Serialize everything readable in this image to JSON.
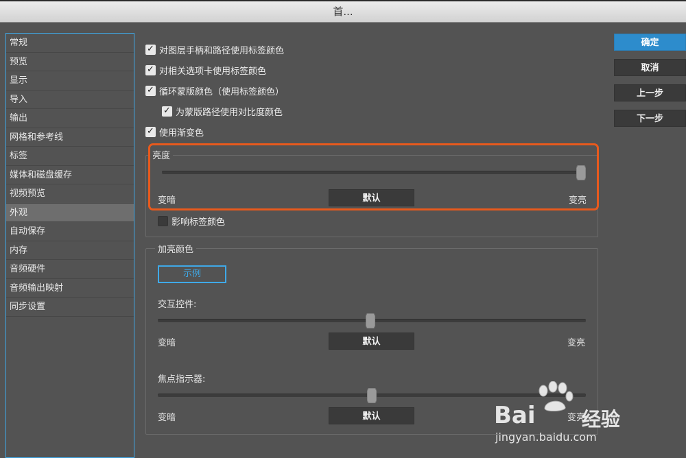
{
  "window": {
    "title": "首..."
  },
  "sidebar": {
    "items": [
      {
        "label": "常规"
      },
      {
        "label": "预览"
      },
      {
        "label": "显示"
      },
      {
        "label": "导入"
      },
      {
        "label": "输出"
      },
      {
        "label": "网格和参考线"
      },
      {
        "label": "标签"
      },
      {
        "label": "媒体和磁盘缓存"
      },
      {
        "label": "视频预览"
      },
      {
        "label": "外观"
      },
      {
        "label": "自动保存"
      },
      {
        "label": "内存"
      },
      {
        "label": "音频硬件"
      },
      {
        "label": "音频输出映射"
      },
      {
        "label": "同步设置"
      }
    ],
    "selected": "外观"
  },
  "options": {
    "layer_handles": {
      "label": "对图层手柄和路径使用标签颜色",
      "checked": true
    },
    "related_tabs": {
      "label": "对相关选项卡使用标签颜色",
      "checked": true
    },
    "cycle_mask": {
      "label": "循环蒙版颜色（使用标签颜色）",
      "checked": true
    },
    "mask_contrast": {
      "label": "为蒙版路径使用对比度颜色",
      "checked": true
    },
    "use_gradients": {
      "label": "使用渐变色",
      "checked": true
    },
    "affect_label": {
      "label": "影响标签颜色",
      "checked": false
    }
  },
  "brightness": {
    "title": "亮度",
    "darker": "变暗",
    "default_label": "默认",
    "lighter": "变亮",
    "value": 1.0
  },
  "highlight": {
    "title": "加亮颜色",
    "sample_label": "示例",
    "interactive": {
      "label": "交互控件:",
      "darker": "变暗",
      "default_label": "默认",
      "lighter": "变亮",
      "value": 0.5
    },
    "focus": {
      "label": "焦点指示器:",
      "darker": "变暗",
      "default_label": "默认",
      "lighter": "变亮",
      "value": 0.5
    }
  },
  "buttons": {
    "ok": "确定",
    "cancel": "取消",
    "prev": "上一步",
    "next": "下一步"
  },
  "colors": {
    "accent": "#3fa9e8",
    "primary_button": "#2d8ccc",
    "highlight_outline": "#e85a1d",
    "background": "#535353"
  },
  "watermark": {
    "brand": "Bai",
    "brand2": "经验",
    "url": "jingyan.baidu.com"
  }
}
